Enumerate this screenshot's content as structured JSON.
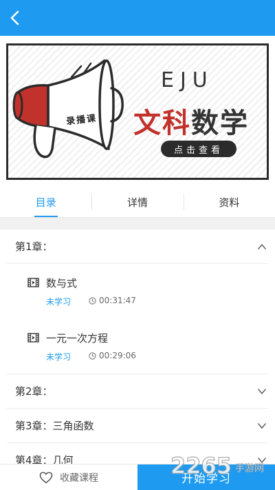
{
  "colors": {
    "accent": "#1e9bf0",
    "banner_red": "#c0322b",
    "divider": "#ececec"
  },
  "header": {
    "back_icon": "chevron-left-icon"
  },
  "banner": {
    "tag": "录播课",
    "eju": "EJU",
    "title_part1": "文科",
    "title_part2": "数学",
    "cta": "点击查看",
    "icon": "megaphone-icon"
  },
  "tabs": [
    {
      "label": "目录",
      "active": true
    },
    {
      "label": "详情",
      "active": false
    },
    {
      "label": "资料",
      "active": false
    }
  ],
  "chapters": [
    {
      "title": "第1章：",
      "expanded": true,
      "lessons": [
        {
          "name": "数与式",
          "status": "未学习",
          "duration": "00:31:47"
        },
        {
          "name": "一元一次方程",
          "status": "未学习",
          "duration": "00:29:06"
        }
      ]
    },
    {
      "title": "第2章：",
      "expanded": false
    },
    {
      "title": "第3章：三角函数",
      "expanded": false
    },
    {
      "title": "第4章：几何",
      "expanded": false
    }
  ],
  "bottom": {
    "favorite_label": "收藏课程",
    "start_label": "开始学习"
  },
  "watermark": {
    "brand": "2265",
    "suffix": "手游网"
  }
}
